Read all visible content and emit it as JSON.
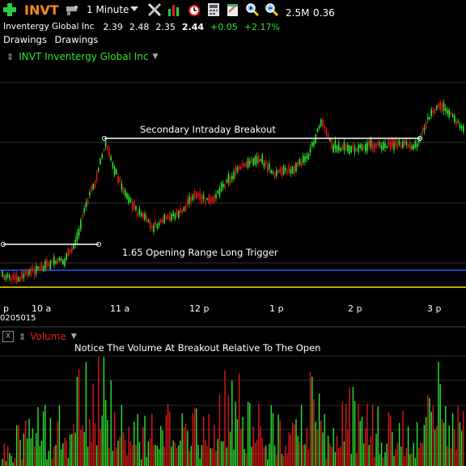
{
  "toolbar": {
    "symbol": "INVT",
    "interval": "1 Minute",
    "volume_readout": "2.5M",
    "value_readout": "0.36",
    "icons": [
      "add-icon",
      "gun-icon",
      "interval-dropdown-icon",
      "tools-icon",
      "bar-chart-icon",
      "alarm-clock-icon",
      "calculator-icon",
      "notepad-icon",
      "zoom-in-icon",
      "zoom-out-icon"
    ]
  },
  "quote": {
    "name": "Inventergy Global Inc",
    "open": "2.39",
    "high": "2.48",
    "low": "2.35",
    "last": "2.44",
    "change": "+0.05",
    "change_pct": "+2.17%"
  },
  "drawings": {
    "label1": "Drawings",
    "label2": "Drawings"
  },
  "chart": {
    "title": "INVT Inventergy Global Inc",
    "annotations": {
      "breakout": "Secondary Intraday Breakout",
      "trigger": "1.65 Opening Range Long Trigger",
      "volume_note": "Notice The Volume At Breakout Relative To The Open"
    },
    "time_ticks": [
      "p",
      "10 a",
      "11 a",
      "12 p",
      "1 p",
      "2 p",
      "3 p"
    ],
    "date_label": "0205015",
    "colors": {
      "up": "#2ee52e",
      "down": "#e01818",
      "blue_line": "#2060ff",
      "yellow_line": "#ffe000",
      "grid": "#333333"
    }
  },
  "volume": {
    "label": "Volume"
  }
}
